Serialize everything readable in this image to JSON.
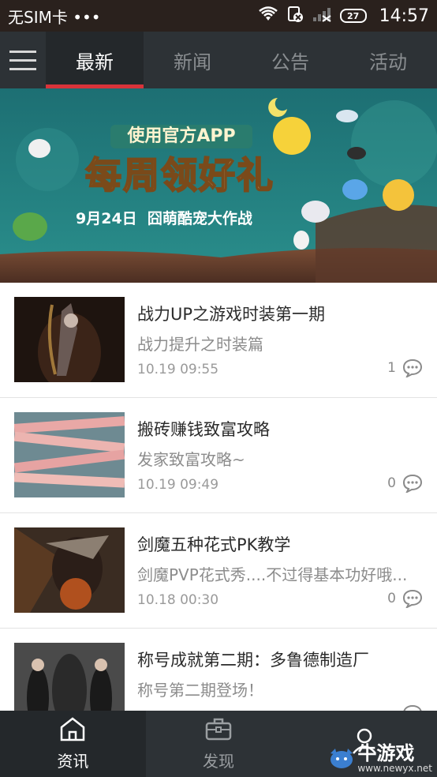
{
  "status_bar": {
    "carrier": "无SIM卡 •••",
    "battery": "27",
    "time": "14:57"
  },
  "top_nav": {
    "tabs": [
      {
        "label": "最新",
        "active": true
      },
      {
        "label": "新闻",
        "active": false
      },
      {
        "label": "公告",
        "active": false
      },
      {
        "label": "活动",
        "active": false
      }
    ]
  },
  "banner": {
    "subtitle": "使用官方APP",
    "headline": "每周领好礼",
    "event": "9月24日  囧萌酷宠大作战"
  },
  "articles": [
    {
      "title": "战力UP之游戏时装第一期",
      "summary": "战力提升之时装篇",
      "date": "10.19 09:55",
      "comments": "1"
    },
    {
      "title": "搬砖赚钱致富攻略",
      "summary": "发家致富攻略~",
      "date": "10.19 09:49",
      "comments": "0"
    },
    {
      "title": "剑魔五种花式PK教学",
      "summary": "剑魔PVP花式秀....不过得基本功好哦...",
      "date": "10.18 00:30",
      "comments": "0"
    },
    {
      "title": "称号成就第二期：多鲁德制造厂",
      "summary": "称号第二期登场！",
      "date": "",
      "comments": ""
    }
  ],
  "bottom_nav": {
    "items": [
      {
        "label": "资讯",
        "icon": "home-icon",
        "active": true
      },
      {
        "label": "发现",
        "icon": "briefcase-icon",
        "active": false
      },
      {
        "label": "",
        "icon": "user-icon",
        "active": false
      }
    ]
  },
  "watermark": {
    "title": "牛游戏",
    "url": "www.newyx.net"
  },
  "colors": {
    "status_bar": "#2a211d",
    "nav_bg": "#2d3236",
    "accent": "#d8333a",
    "banner_teal": "#1f7a7c"
  }
}
